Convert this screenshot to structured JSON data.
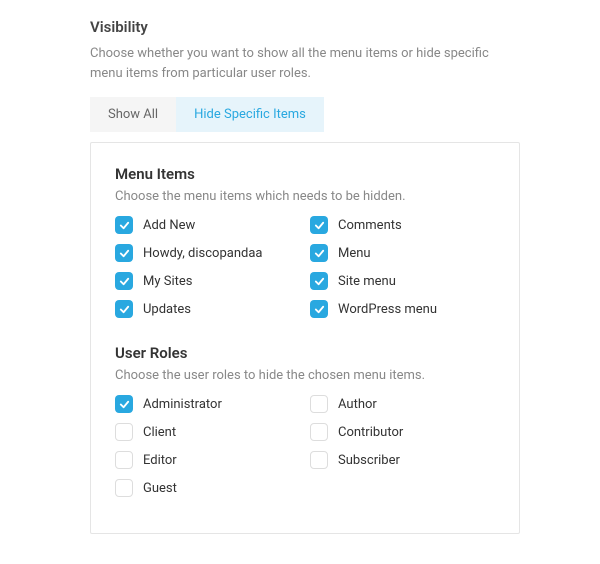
{
  "section": {
    "title": "Visibility",
    "description": "Choose whether you want to show all the menu items or hide specific menu items from particular user roles."
  },
  "tabs": {
    "show_all": "Show All",
    "hide_specific": "Hide Specific Items"
  },
  "menu_items": {
    "title": "Menu Items",
    "description": "Choose the menu items which needs to be hidden.",
    "items": [
      {
        "label": "Add New",
        "checked": true
      },
      {
        "label": "Comments",
        "checked": true
      },
      {
        "label": "Howdy, discopandaa",
        "checked": true
      },
      {
        "label": "Menu",
        "checked": true
      },
      {
        "label": "My Sites",
        "checked": true
      },
      {
        "label": "Site menu",
        "checked": true
      },
      {
        "label": "Updates",
        "checked": true
      },
      {
        "label": "WordPress menu",
        "checked": true
      }
    ]
  },
  "user_roles": {
    "title": "User Roles",
    "description": "Choose the user roles to hide the chosen menu items.",
    "items": [
      {
        "label": "Administrator",
        "checked": true
      },
      {
        "label": "Author",
        "checked": false
      },
      {
        "label": "Client",
        "checked": false
      },
      {
        "label": "Contributor",
        "checked": false
      },
      {
        "label": "Editor",
        "checked": false
      },
      {
        "label": "Subscriber",
        "checked": false
      },
      {
        "label": "Guest",
        "checked": false
      }
    ]
  }
}
